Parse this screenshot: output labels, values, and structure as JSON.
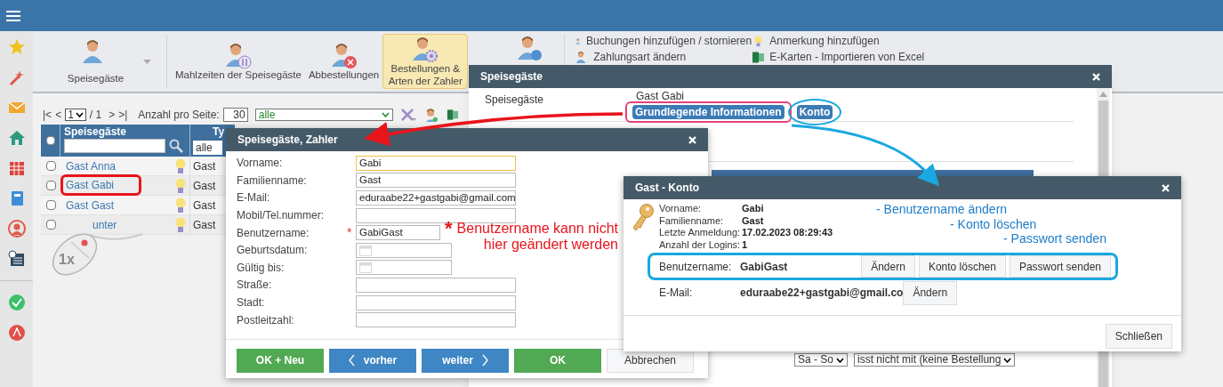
{
  "toolbar": {
    "buttons": [
      {
        "label": "Speisegäste",
        "selected": false,
        "dropdown": true
      },
      {
        "label": "Mahlzeiten der Speisegäste",
        "selected": false,
        "dropdown": false
      },
      {
        "label": "Abbestellungen",
        "selected": false,
        "dropdown": false
      },
      {
        "label": "Bestellungen & Arten der Zahler",
        "selected": true,
        "dropdown": false
      }
    ],
    "actions": [
      {
        "label": "Buchungen hinzufügen / stornieren"
      },
      {
        "label": "Anmerkung hinzufügen"
      },
      {
        "label": "Zahlungsart ändern"
      },
      {
        "label": "E-Karten - Importieren von Excel"
      }
    ]
  },
  "pager": {
    "first": "|<",
    "prev": "<",
    "page": "1",
    "of": "/ 1",
    "next": ">",
    "last": ">|",
    "per_page_label": "Anzahl pro Seite:",
    "per_page": "30",
    "filter": "alle"
  },
  "grid": {
    "header_checked": false,
    "columns": [
      "Speisegäste",
      "Ty"
    ],
    "type_filter": "alle",
    "rows": [
      {
        "name": "Gast Anna",
        "type": "Gast",
        "checked": false,
        "highlighted": false
      },
      {
        "name": "Gast Gabi",
        "type": "Gast",
        "checked": false,
        "highlighted": true
      },
      {
        "name": "Gast Gast",
        "type": "Gast",
        "checked": false,
        "highlighted": false
      },
      {
        "name": "unter",
        "type": "Gast",
        "checked": false,
        "highlighted": false
      }
    ]
  },
  "main_dialog": {
    "title": "Speisegäste",
    "label": "Speisegäste",
    "value": "Gast Gabi",
    "tabs": [
      {
        "label": "Grundlegende Informationen",
        "kind": "frame"
      },
      {
        "label": "Konto",
        "kind": "ellipse"
      }
    ],
    "selects": [
      "Sa - So",
      "isst nicht mit (keine Bestellung"
    ]
  },
  "payer_dialog": {
    "title": "Speisegäste, Zahler",
    "fields": [
      {
        "label": "Vorname:",
        "value": "Gabi",
        "kind": "text",
        "focused": true
      },
      {
        "label": "Familienname:",
        "value": "Gast",
        "kind": "text",
        "focused": false
      },
      {
        "label": "E-Mail:",
        "value": "eduraabe22+gastgabi@gmail.com",
        "kind": "text",
        "focused": false
      },
      {
        "label": "Mobil/Tel.nummer:",
        "kind": "text",
        "focused": false
      },
      {
        "label": "Benutzername:",
        "value": "GabiGast",
        "kind": "short",
        "focused": false,
        "required_mark": "*"
      },
      {
        "label": "Geburtsdatum:",
        "kind": "date",
        "focused": false
      },
      {
        "label": "Gültig bis:",
        "kind": "date",
        "focused": false
      },
      {
        "label": "Straße:",
        "kind": "text",
        "focused": false
      },
      {
        "label": "Stadt:",
        "kind": "text",
        "focused": false
      },
      {
        "label": "Postleitzahl:",
        "kind": "text",
        "focused": false
      }
    ],
    "buttons": [
      {
        "label": "OK + Neu",
        "kind": "success"
      },
      {
        "label": "vorher",
        "kind": "prev"
      },
      {
        "label": "weiter",
        "kind": "next"
      },
      {
        "label": "OK",
        "kind": "success"
      },
      {
        "label": "Abbrechen",
        "kind": "default"
      }
    ]
  },
  "account_dialog": {
    "title": "Gast - Konto",
    "info": [
      {
        "label": "Vorname:",
        "value": "Gabi"
      },
      {
        "label": "Familienname:",
        "value": "Gast"
      },
      {
        "label": "Letzte Anmeldung:",
        "value": "17.02.2023 08:29:43"
      },
      {
        "label": "Anzahl der Logins:",
        "value": "1"
      }
    ],
    "username": {
      "label": "Benutzername:",
      "value": "GabiGast",
      "actions": [
        "Ändern",
        "Konto löschen",
        "Passwort senden"
      ]
    },
    "email": {
      "label": "E-Mail:",
      "value": "eduraabe22+gastgabi@gmail.co",
      "action": "Ändern"
    },
    "close": "Schließen"
  },
  "annotations": {
    "note_mark": "*",
    "note_lines": [
      "Benutzername kann nicht",
      "hier geändert werden"
    ],
    "steps": [
      "- Benutzername ändern",
      "- Konto löschen",
      "- Passwort senden"
    ],
    "click_label": "1x"
  }
}
